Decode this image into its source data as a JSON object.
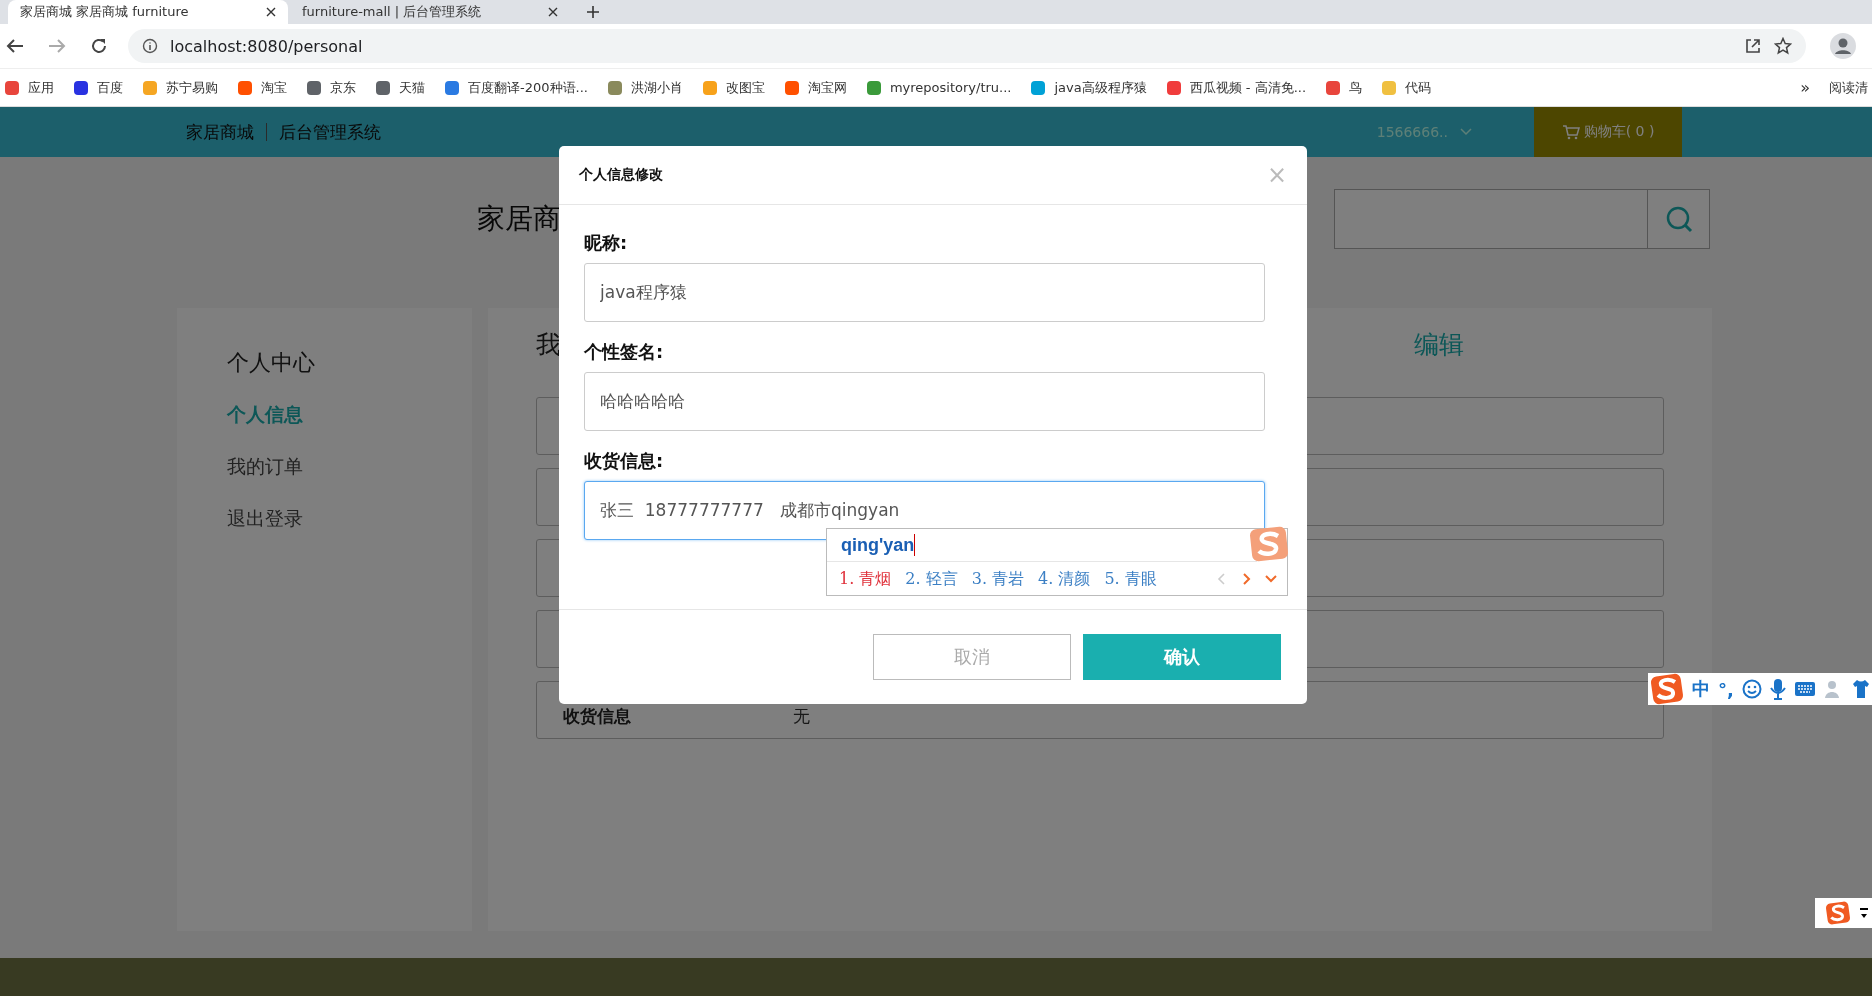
{
  "browser": {
    "tabs": [
      {
        "title": "家居商城 家居商城 furniture",
        "selected": true
      },
      {
        "title": "furniture-mall | 后台管理系统",
        "selected": false
      }
    ],
    "address": "localhost:8080/personal",
    "bookmarks": [
      {
        "label": "应用",
        "color": "#e8453c"
      },
      {
        "label": "百度",
        "color": "#2932e1"
      },
      {
        "label": "苏宁易购",
        "color": "#f5a623"
      },
      {
        "label": "淘宝",
        "color": "#ff5000"
      },
      {
        "label": "京东",
        "color": "#5f6368"
      },
      {
        "label": "天猫",
        "color": "#5f6368"
      },
      {
        "label": "百度翻译-200种语...",
        "color": "#2a7ae2"
      },
      {
        "label": "洪湖小肖",
        "color": "#8a8a5c"
      },
      {
        "label": "改图宝",
        "color": "#f7a21b"
      },
      {
        "label": "淘宝网",
        "color": "#ff5000"
      },
      {
        "label": "myrepository/tru...",
        "color": "#3a9a3a"
      },
      {
        "label": "java高级程序猿",
        "color": "#00a1d6"
      },
      {
        "label": "西瓜视频 - 高清免...",
        "color": "#f03c3c"
      },
      {
        "label": "鸟",
        "color": "#e8453c"
      },
      {
        "label": "代码",
        "color": "#f0c040"
      }
    ],
    "more": "»",
    "reading": "阅读清"
  },
  "site": {
    "brand": "家居商城",
    "admin": "后台管理系统",
    "user": "1566666..",
    "cart": "购物车( 0 )",
    "logo_text": "家居商",
    "sidebar": {
      "title": "个人中心",
      "items": [
        {
          "label": "个人信息",
          "selected": true
        },
        {
          "label": "我的订单",
          "selected": false
        },
        {
          "label": "退出登录",
          "selected": false
        }
      ]
    },
    "panel": {
      "title": "我",
      "edit": "编辑",
      "rows": [
        {
          "kind": "blank"
        },
        {
          "kind": "blank"
        },
        {
          "kind": "blank"
        },
        {
          "kind": "blank"
        },
        {
          "kind": "text",
          "label": "收货信息",
          "value": "无"
        }
      ]
    }
  },
  "modal": {
    "title": "个人信息修改",
    "close": "×",
    "fields": [
      {
        "label": "昵称:",
        "value": "java程序猿",
        "focused": false
      },
      {
        "label": "个性签名:",
        "value": "哈哈哈哈哈",
        "focused": false
      },
      {
        "label": "收货信息:",
        "value": "张三  18777777777   成都市qingyan",
        "focused": true
      }
    ],
    "cancel": "取消",
    "confirm": "确认"
  },
  "ime": {
    "composition": "qing'yan",
    "candidates": [
      {
        "label": "1. 青烟",
        "selected": true
      },
      {
        "label": "2. 轻言",
        "selected": false
      },
      {
        "label": "3. 青岩",
        "selected": false
      },
      {
        "label": "4. 清颜",
        "selected": false
      },
      {
        "label": "5. 青眼",
        "selected": false
      }
    ],
    "toolbar": {
      "mode": "中",
      "punct": "°,"
    }
  }
}
